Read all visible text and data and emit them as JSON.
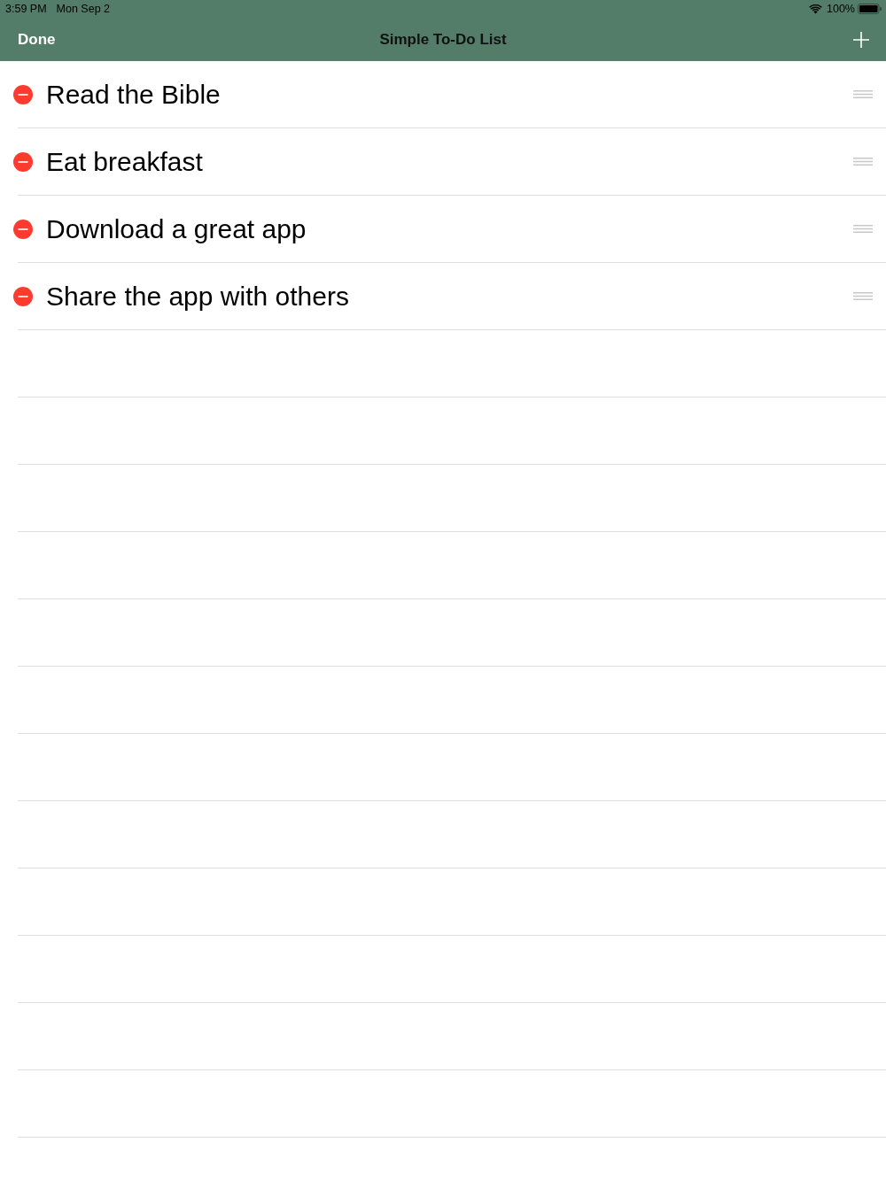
{
  "status_bar": {
    "time": "3:59 PM",
    "date": "Mon Sep 2",
    "battery": "100%"
  },
  "nav_bar": {
    "left_button": "Done",
    "title": "Simple To-Do List"
  },
  "items": [
    {
      "title": "Read the Bible"
    },
    {
      "title": "Eat breakfast"
    },
    {
      "title": "Download a great app"
    },
    {
      "title": "Share the app with others"
    }
  ]
}
